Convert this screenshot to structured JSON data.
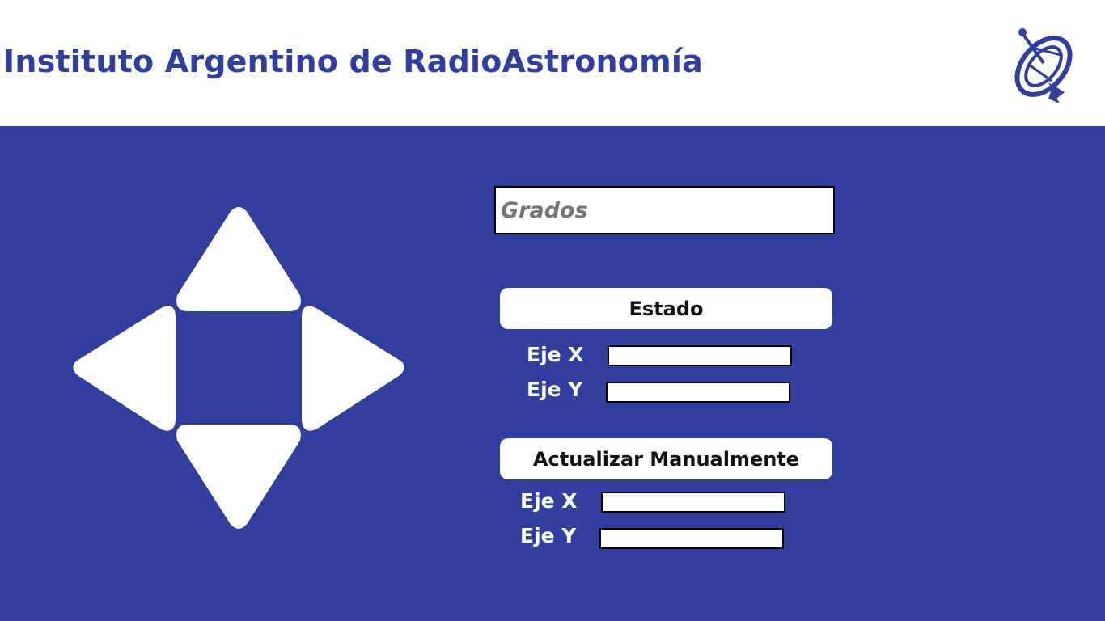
{
  "header": {
    "title": "Instituto Argentino de RadioAstronomía",
    "logo_icon": "radio-telescope-icon",
    "brand_color": "#323e9e"
  },
  "main": {
    "background_color": "#323e9e",
    "dpad": {
      "up_icon": "arrow-up-icon",
      "down_icon": "arrow-down-icon",
      "left_icon": "arrow-left-icon",
      "right_icon": "arrow-right-icon"
    },
    "grados": {
      "placeholder": "Grados",
      "value": ""
    },
    "estado": {
      "label": "Estado",
      "eje_x_label": "Eje X",
      "eje_x_value": "",
      "eje_y_label": "Eje Y",
      "eje_y_value": ""
    },
    "manual": {
      "label": "Actualizar Manualmente",
      "eje_x_label": "Eje X",
      "eje_x_value": "",
      "eje_y_label": "Eje Y",
      "eje_y_value": ""
    }
  }
}
